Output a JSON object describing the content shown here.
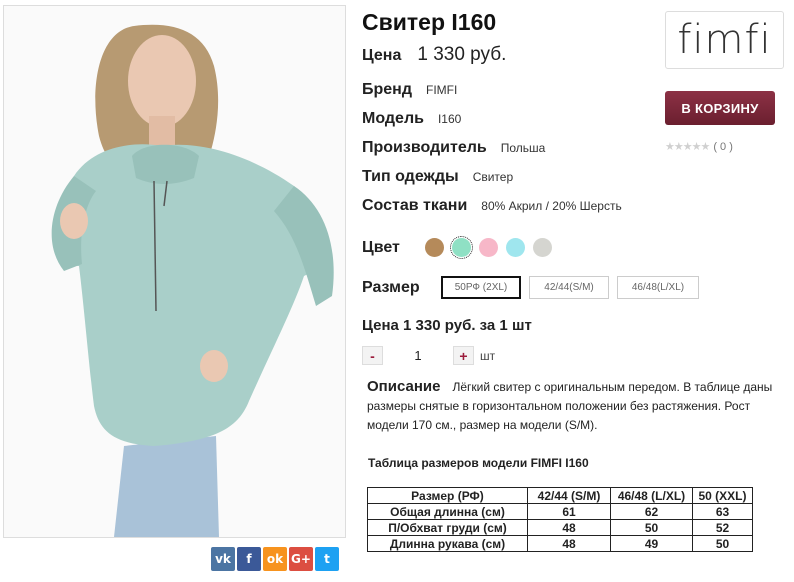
{
  "product": {
    "title": "Свитер I160",
    "price_label": "Цена",
    "price_value": "1 330 руб."
  },
  "specs": [
    {
      "key": "Бренд",
      "value": "FIMFI"
    },
    {
      "key": "Модель",
      "value": "I160"
    },
    {
      "key": "Производитель",
      "value": "Польша"
    },
    {
      "key": "Тип одежды",
      "value": "Свитер"
    },
    {
      "key": "Состав ткани",
      "value": "80% Акрил / 20% Шерсть"
    }
  ],
  "brand_logo": "fimfi",
  "cart": {
    "label": "В КОРЗИНУ",
    "color": "#7a2538"
  },
  "rating": {
    "stars": "★★★★★",
    "count": "( 0 )"
  },
  "colors": {
    "label": "Цвет",
    "swatches": [
      "#b58a5a",
      "#8fe0c4",
      "#f7b7c8",
      "#9fe6ee",
      "#d5d5d0"
    ],
    "selected": 1
  },
  "sizes": {
    "label": "Размер",
    "options": [
      "50РФ (2XL)",
      "42/44(S/M)",
      "46/48(L/XL)"
    ],
    "selected": 0
  },
  "total": "Цена 1 330 руб. за 1 шт",
  "quantity": {
    "minus": "-",
    "value": "1",
    "plus": "+",
    "unit": "шт"
  },
  "description": {
    "heading": "Описание",
    "text": "Лёгкий свитер с оригинальным передом. В таблице даны размеры снятые в горизонтальном положении без растяжения. Рост модели 170 см., размер на модели (S/M)."
  },
  "size_table": {
    "caption": "Таблица размеров модели FIMFI  I160",
    "headers": [
      "Размер (РФ)",
      "42/44 (S/M)",
      "46/48 (L/XL)",
      "50 (XXL)"
    ],
    "rows": [
      [
        "Общая длинна (см)",
        "61",
        "62",
        "63"
      ],
      [
        "П/Обхват груди (см)",
        "48",
        "50",
        "52"
      ],
      [
        "Длинна рукава (см)",
        "48",
        "49",
        "50"
      ]
    ]
  },
  "share": [
    {
      "icon": "vk-icon",
      "glyph": "vk",
      "color": "#4c75a3"
    },
    {
      "icon": "facebook-icon",
      "glyph": "f",
      "color": "#3b5998"
    },
    {
      "icon": "odnoklassniki-icon",
      "glyph": "ok",
      "color": "#f7931e"
    },
    {
      "icon": "googleplus-icon",
      "glyph": "G+",
      "color": "#dc4e41"
    },
    {
      "icon": "twitter-icon",
      "glyph": "t",
      "color": "#1da1f2"
    }
  ]
}
